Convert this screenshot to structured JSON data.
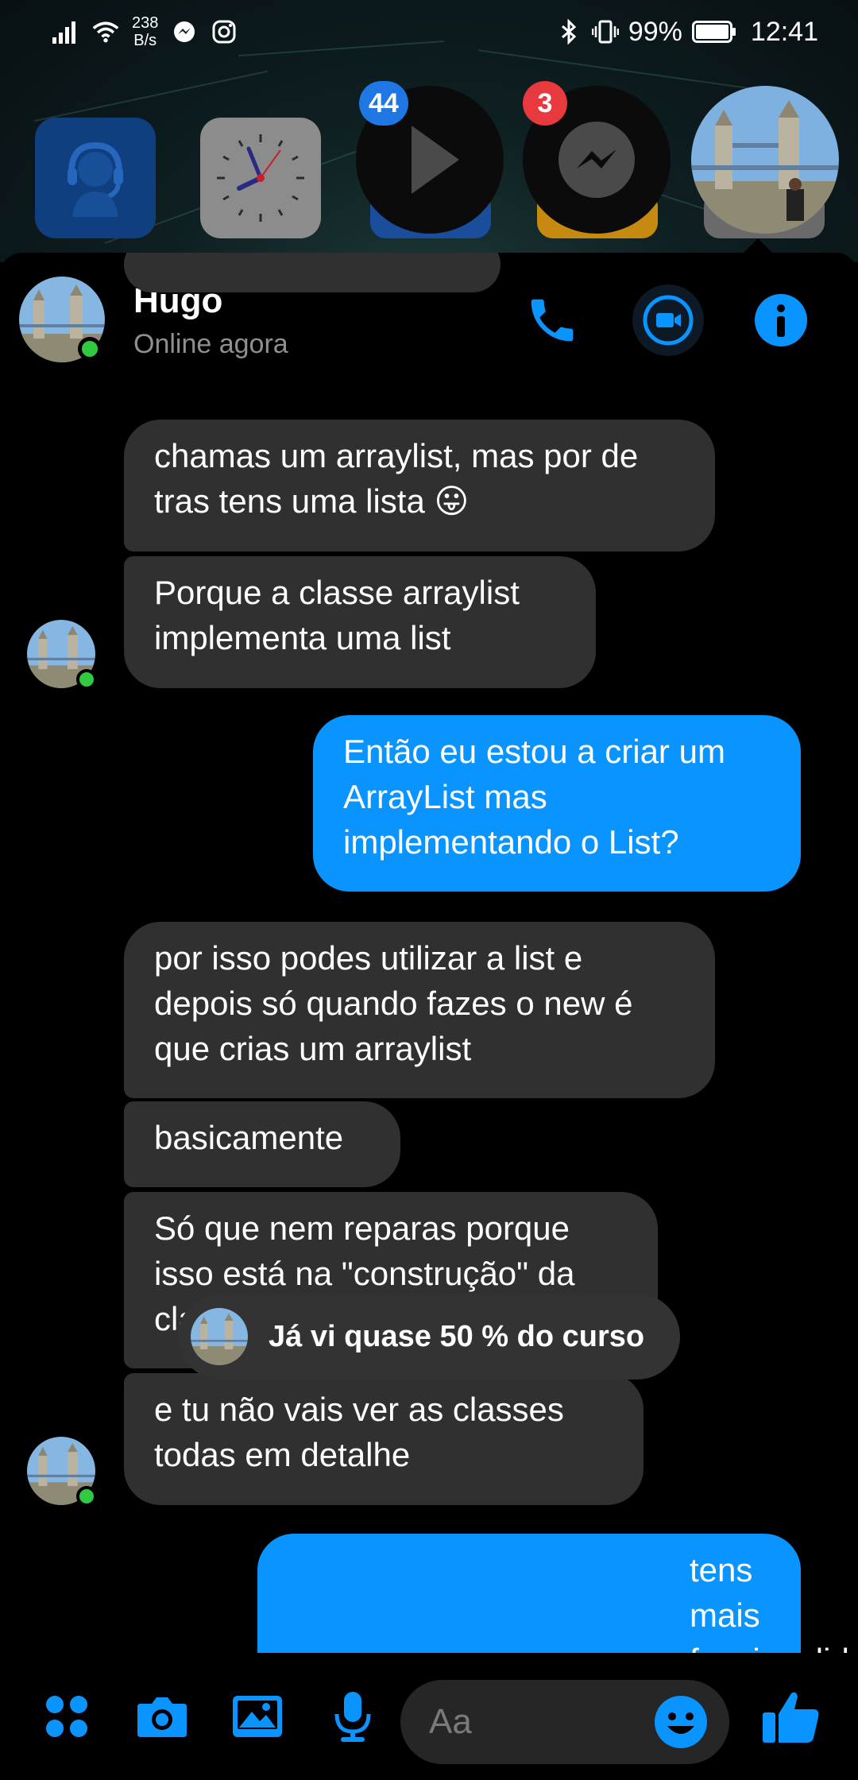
{
  "status_bar": {
    "net_speed_value": "238",
    "net_speed_unit": "B/s",
    "battery": "99%",
    "time": "12:41"
  },
  "chat_heads": {
    "video_badge": "44",
    "messenger_badge": "3"
  },
  "header": {
    "contact_name": "Hugo",
    "contact_status": "Online agora"
  },
  "messages": [
    {
      "side": "in",
      "text": "chamas um arraylist, mas por de tras tens uma lista 😛"
    },
    {
      "side": "in",
      "text": "Porque a classe arraylist implementa uma list"
    },
    {
      "side": "out",
      "text": "Então eu estou a criar um ArrayList mas implementando o List?"
    },
    {
      "side": "in",
      "text": "por isso podes utilizar a list e depois só quando fazes o new é que crias um arraylist"
    },
    {
      "side": "in",
      "text": "basicamente"
    },
    {
      "side": "in",
      "text": "Só que nem reparas porque isso está na \"construção\" da classe"
    },
    {
      "side": "in",
      "text": "e tu não vais ver as classes todas em detalhe"
    },
    {
      "side": "out",
      "text": "tens mais funcionalidades do"
    }
  ],
  "toast": {
    "text": "Já vi quase 50 % do curso"
  },
  "composer": {
    "placeholder": "Aa"
  },
  "colors": {
    "accent": "#0a94ff",
    "incoming_bubble": "#303030",
    "online": "#31c940",
    "badge_blue": "#1f77e4",
    "badge_red": "#e8393f"
  }
}
